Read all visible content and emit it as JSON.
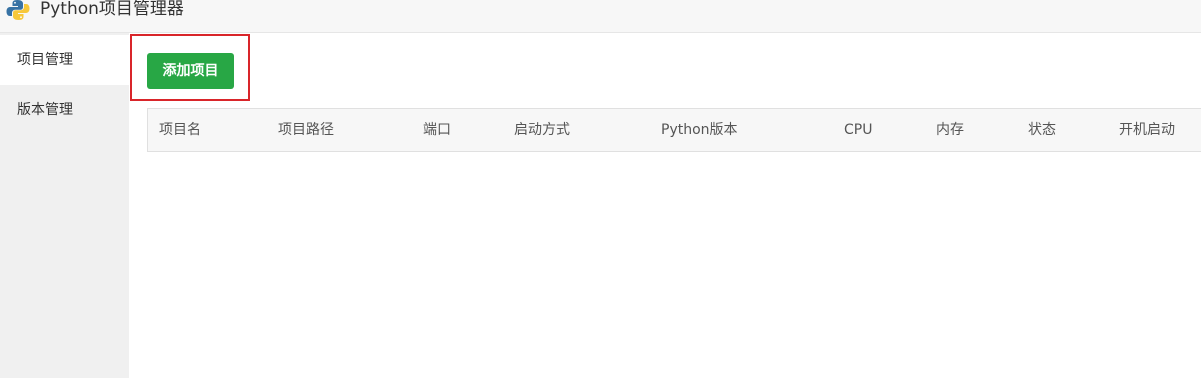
{
  "app": {
    "title": "Python项目管理器",
    "icon": "python-logo-icon"
  },
  "sidebar": {
    "items": [
      {
        "label": "项目管理",
        "active": true
      },
      {
        "label": "版本管理",
        "active": false
      }
    ]
  },
  "toolbar": {
    "add_label": "添加项目",
    "add_color": "#28a745",
    "highlight_color": "#d9252a"
  },
  "table": {
    "columns": [
      "项目名",
      "项目路径",
      "端口",
      "启动方式",
      "Python版本",
      "CPU",
      "内存",
      "状态",
      "开机启动"
    ],
    "rows": []
  }
}
